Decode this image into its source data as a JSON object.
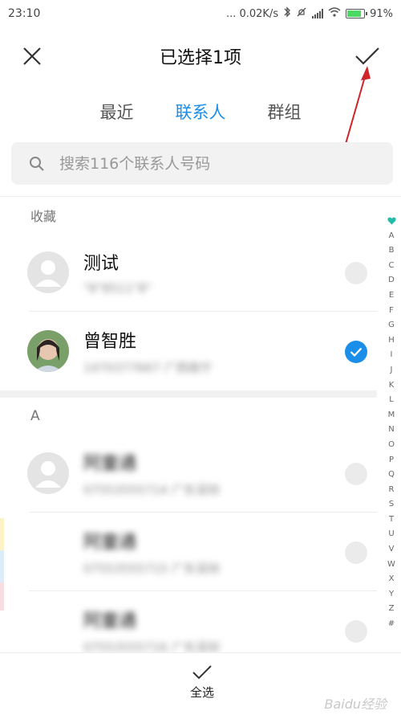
{
  "status_bar": {
    "time": "23:10",
    "network_speed": "... 0.02K/s",
    "battery_percent": "91%",
    "battery_level": 0.91
  },
  "header": {
    "title": "已选择1项"
  },
  "tabs": [
    {
      "label": "最近",
      "active": false
    },
    {
      "label": "联系人",
      "active": true
    },
    {
      "label": "群组",
      "active": false
    }
  ],
  "search": {
    "placeholder": "搜索116个联系人号码"
  },
  "sections": {
    "favorites": "收藏",
    "a": "A"
  },
  "contacts": [
    {
      "name": "测试",
      "detail": "\"8\"8511\"8\"",
      "selected": false
    },
    {
      "name": "曾智胜",
      "detail": "1470377667 广西南宁",
      "selected": true
    },
    {
      "name": "阿童通",
      "detail": "07553555714 广东深圳",
      "selected": false
    },
    {
      "name": "阿童通",
      "detail": "07553555715 广东深圳",
      "selected": false
    },
    {
      "name": "阿童通",
      "detail": "07553555716 广东深圳",
      "selected": false
    }
  ],
  "alphabet_index": [
    "A",
    "B",
    "C",
    "D",
    "E",
    "F",
    "G",
    "H",
    "I",
    "J",
    "K",
    "L",
    "M",
    "N",
    "O",
    "P",
    "Q",
    "R",
    "S",
    "T",
    "U",
    "V",
    "W",
    "X",
    "Y",
    "Z",
    "#"
  ],
  "bottom_bar": {
    "select_all_label": "全选"
  },
  "watermark": "Baidu经验",
  "colors": {
    "accent": "#1a8ee8",
    "annotation_arrow": "#d0242b",
    "index_heart": "#26b9a7",
    "battery_fill": "#4cd964"
  }
}
